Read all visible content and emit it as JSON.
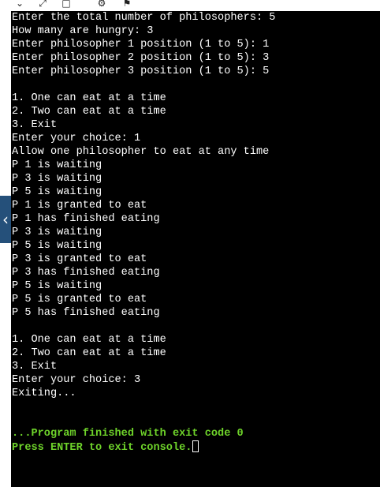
{
  "toolbar": {
    "icons": [
      "chevron-down-icon",
      "expand-icon",
      "run-icon",
      "gear-icon",
      "debug-icon"
    ]
  },
  "console": {
    "lines": [
      "Enter the total number of philosophers: 5",
      "How many are hungry: 3",
      "Enter philosopher 1 position (1 to 5): 1",
      "Enter philosopher 2 position (1 to 5): 3",
      "Enter philosopher 3 position (1 to 5): 5",
      "",
      "1. One can eat at a time",
      "2. Two can eat at a time",
      "3. Exit",
      "Enter your choice: 1",
      "Allow one philosopher to eat at any time",
      "P 1 is waiting",
      "P 3 is waiting",
      "P 5 is waiting",
      "P 1 is granted to eat",
      "P 1 has finished eating",
      "P 3 is waiting",
      "P 5 is waiting",
      "P 3 is granted to eat",
      "P 3 has finished eating",
      "P 5 is waiting",
      "P 5 is granted to eat",
      "P 5 has finished eating",
      "",
      "1. One can eat at a time",
      "2. Two can eat at a time",
      "3. Exit",
      "Enter your choice: 3",
      "Exiting...",
      "",
      "",
      "...Program finished with exit code 0",
      "Press ENTER to exit console."
    ]
  },
  "colors": {
    "background": "#000000",
    "text": "#ffffff",
    "status_text": "#6ed32a",
    "side_strip": "#25507a"
  }
}
